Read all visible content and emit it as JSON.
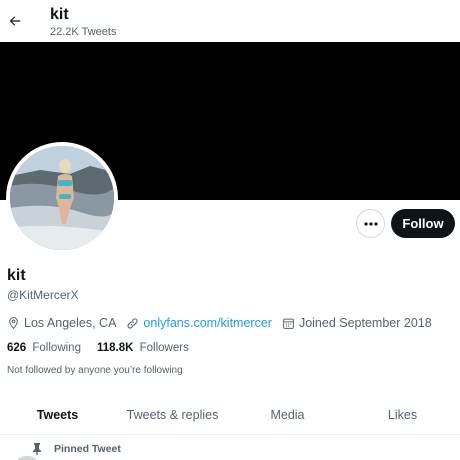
{
  "header": {
    "title": "kit",
    "tweet_count": "22.2K Tweets"
  },
  "profile": {
    "display_name": "kit",
    "handle": "@KitMercerX",
    "location": "Los Angeles, CA",
    "website": "onlyfans.com/kitmercer",
    "joined": "Joined September 2018",
    "following_count": "626",
    "following_label": "Following",
    "followers_count": "118.8K",
    "followers_label": "Followers",
    "followed_by_note": "Not followed by anyone you’re following"
  },
  "actions": {
    "follow_label": "Follow",
    "more_icon": "more-horizontal-icon"
  },
  "tabs": [
    {
      "label": "Tweets",
      "active": true
    },
    {
      "label": "Tweets & replies",
      "active": false
    },
    {
      "label": "Media",
      "active": false
    },
    {
      "label": "Likes",
      "active": false
    }
  ],
  "pinned": {
    "label": "Pinned Tweet",
    "icon": "pin-icon"
  },
  "colors": {
    "accent": "#1d9bf0",
    "text_primary": "#0f1419",
    "text_secondary": "#536471",
    "banner": "#000000",
    "follow_button": "#0f1419"
  }
}
